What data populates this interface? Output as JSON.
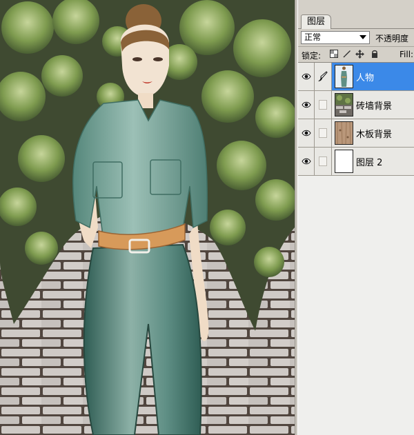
{
  "panel": {
    "tab_label": "图层",
    "blend_mode": "正常",
    "opacity_label": "不透明度",
    "lock_label": "锁定:",
    "fill_label": "Fill:",
    "lock_icons": [
      "lock-transparent-icon",
      "lock-paint-icon",
      "lock-move-icon",
      "lock-all-icon"
    ]
  },
  "layers": [
    {
      "name": "人物",
      "visible": true,
      "selected": true,
      "thumb": "figure-thumbnail"
    },
    {
      "name": "砖墙背景",
      "visible": true,
      "selected": false,
      "thumb": "brick-wall-thumbnail"
    },
    {
      "name": "木板背景",
      "visible": true,
      "selected": false,
      "thumb": "wood-board-thumbnail"
    },
    {
      "name": "图层 2",
      "visible": true,
      "selected": false,
      "thumb": "blank-thumbnail"
    }
  ],
  "colors": {
    "selection": "#3b89e8",
    "outfit": "#5f8f85",
    "belt": "#d79a5a",
    "ivy": "#7c9a4a",
    "brick": "#cbc6c3"
  }
}
